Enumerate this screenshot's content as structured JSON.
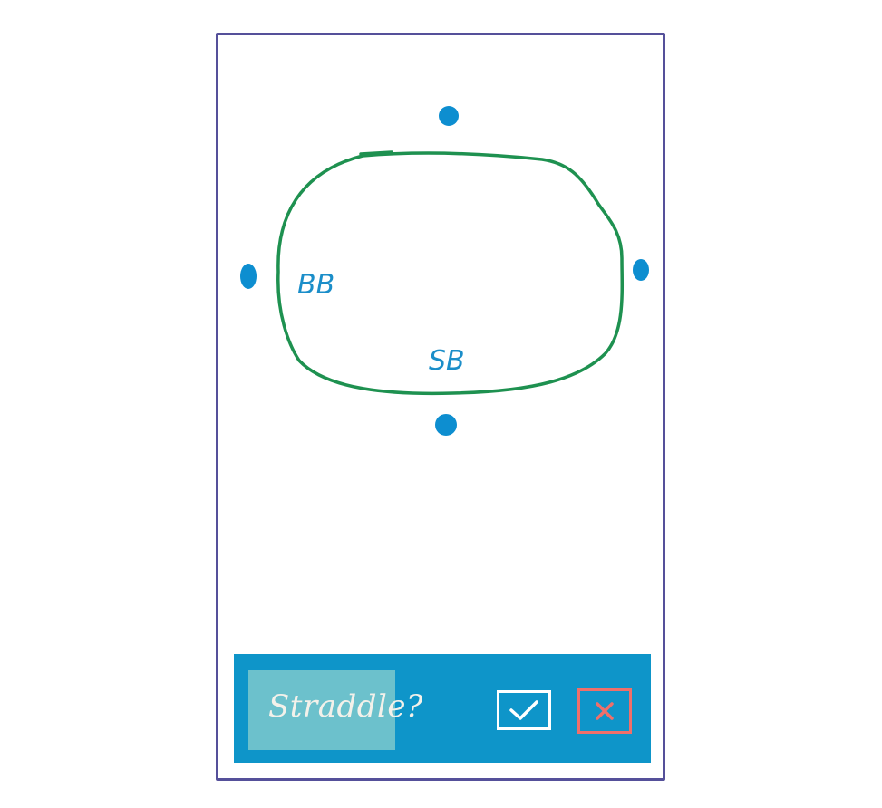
{
  "table": {
    "seats": [
      {
        "label": "BB"
      },
      {
        "label": "SB"
      }
    ]
  },
  "action_bar": {
    "prompt": "Straddle?",
    "confirm_icon": "check-icon",
    "cancel_icon": "close-icon"
  },
  "colors": {
    "frame": "#55509a",
    "table_outline": "#1e9150",
    "seat_dot": "#0d8ed0",
    "seat_label": "#1b8ec9",
    "bar_background": "#0e95c9",
    "prompt_chip": "#6cc1cc",
    "confirm_outline": "#ffffff",
    "cancel_outline": "#ef6f6a"
  }
}
